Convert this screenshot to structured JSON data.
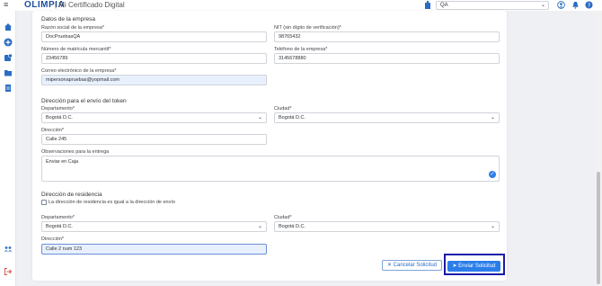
{
  "header": {
    "menu_glyph": "≡",
    "logo": "OLIMPIA",
    "title": "| Mi Certificado Digital",
    "org_select": {
      "value": "QA",
      "chevron": "⌄"
    }
  },
  "form": {
    "company": {
      "title": "Datos de la empresa",
      "razon_social": {
        "label": "Razón social de la empresa*",
        "value": "DocPruebasQA"
      },
      "nit": {
        "label": "NIT (sin dígito de verificación)*",
        "value": "98765432"
      },
      "matricula": {
        "label": "Número de matrícula mercantil*",
        "value": "23456789"
      },
      "telefono": {
        "label": "Teléfono de la empresa*",
        "value": "3145678880"
      },
      "correo": {
        "label": "Correo electrónico de la empresa*",
        "value": "mipersonapruebas@yopmail.com"
      }
    },
    "token_address": {
      "title": "Dirección para el envío del token",
      "departamento": {
        "label": "Departamento*",
        "value": "Bogotá D.C."
      },
      "ciudad": {
        "label": "Ciudad*",
        "value": "Bogotá D.C."
      },
      "direccion": {
        "label": "Dirección*",
        "value": "Calle 245"
      },
      "observaciones": {
        "label": "Observaciones para la entrega",
        "value": "Enviar en Caja"
      }
    },
    "residence": {
      "title": "Dirección de residencia",
      "same_address_label": "La dirección de residencia es igual a la dirección de envío",
      "departamento": {
        "label": "Departamento*",
        "value": "Bogotá D.C."
      },
      "ciudad": {
        "label": "Ciudad*",
        "value": "Bogotá D.C."
      },
      "direccion": {
        "label": "Dirección*",
        "value": "Calle 2 num 123"
      }
    },
    "chevron": "⌄",
    "check_glyph": "✓",
    "cancel_label": "✕ Cancelar Solicitud",
    "send_label": "➤ Enviar Solicitud"
  },
  "colors": {
    "accent": "#2b7de9",
    "brand": "#1a4f9c",
    "logout": "#d9534f",
    "highlight_outline": "#1a1aa8"
  }
}
